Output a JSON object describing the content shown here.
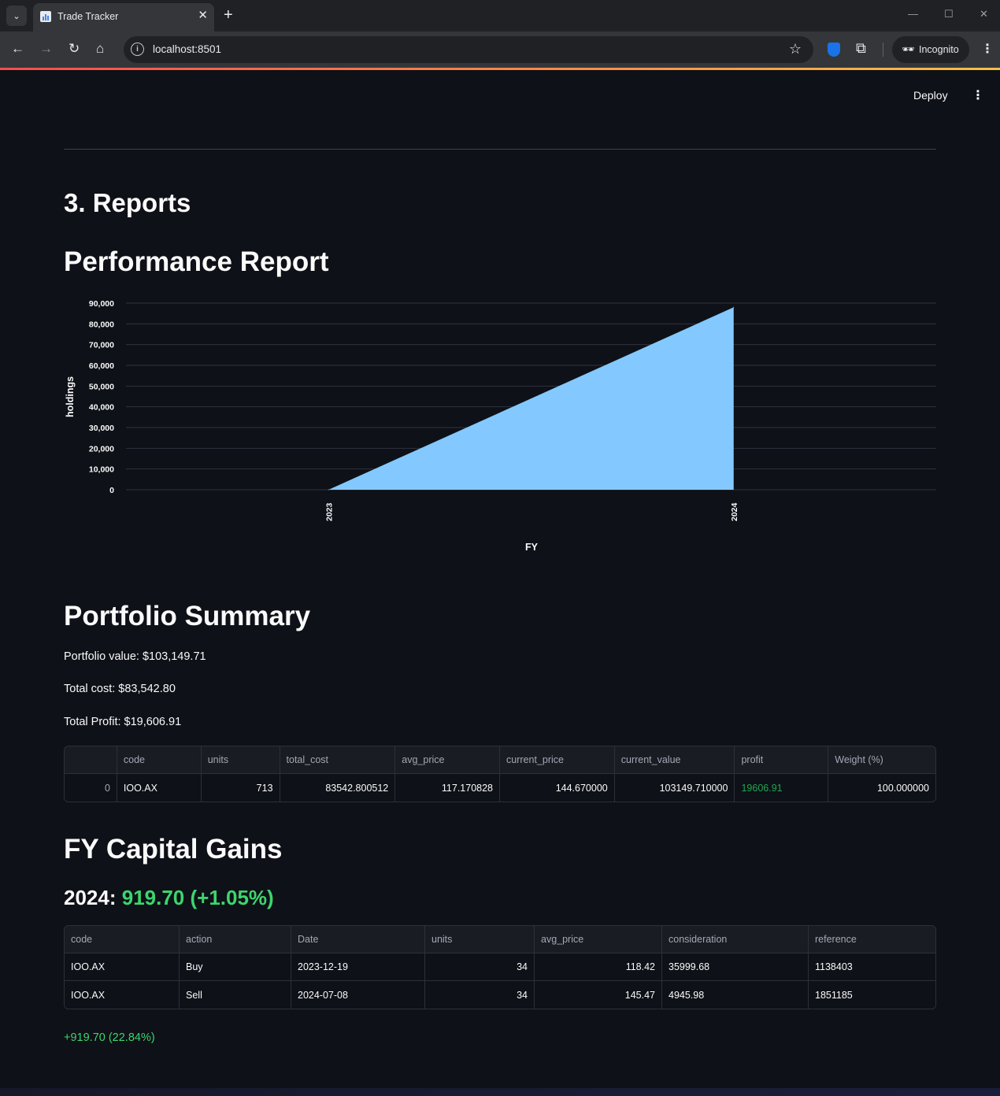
{
  "browser": {
    "tab_title": "Trade Tracker",
    "url": "localhost:8501",
    "incognito_label": "Incognito"
  },
  "app": {
    "deploy_label": "Deploy",
    "section_title": "3. Reports",
    "performance_title": "Performance Report",
    "portfolio_title": "Portfolio Summary",
    "portfolio_value": "Portfolio value: $103,149.71",
    "total_cost": "Total cost: $83,542.80",
    "total_profit": "Total Profit: $19,606.91",
    "capital_gains_title": "FY Capital Gains",
    "fy_label": "2024:",
    "fy_gain": "919.70 (+1.05%)",
    "final_gain": "+919.70 (22.84%)"
  },
  "chart_data": {
    "type": "area",
    "x": [
      "2023",
      "2024"
    ],
    "values": [
      0,
      88000
    ],
    "xlabel": "FY",
    "ylabel": "holdings",
    "ylim": [
      0,
      90000
    ],
    "yticks": [
      "0",
      "10,000",
      "20,000",
      "30,000",
      "40,000",
      "50,000",
      "60,000",
      "70,000",
      "80,000",
      "90,000"
    ],
    "grid": true,
    "color": "#83c9ff"
  },
  "portfolio_table": {
    "headers": [
      "",
      "code",
      "units",
      "total_cost",
      "avg_price",
      "current_price",
      "current_value",
      "profit",
      "Weight (%)"
    ],
    "rows": [
      [
        "0",
        "IOO.AX",
        "713",
        "83542.800512",
        "117.170828",
        "144.670000",
        "103149.710000",
        "19606.91",
        "100.000000"
      ]
    ]
  },
  "gains_table": {
    "headers": [
      "code",
      "action",
      "Date",
      "units",
      "avg_price",
      "consideration",
      "reference"
    ],
    "rows": [
      [
        "IOO.AX",
        "Buy",
        "2023-12-19",
        "34",
        "118.42",
        "35999.68",
        "1138403"
      ],
      [
        "IOO.AX",
        "Sell",
        "2024-07-08",
        "34",
        "145.47",
        "4945.98",
        "1851185"
      ]
    ]
  },
  "colors": {
    "background": "#0e1117",
    "gain_green": "#3dd56d",
    "profit_green": "#21a650",
    "area_fill": "#83c9ff"
  }
}
